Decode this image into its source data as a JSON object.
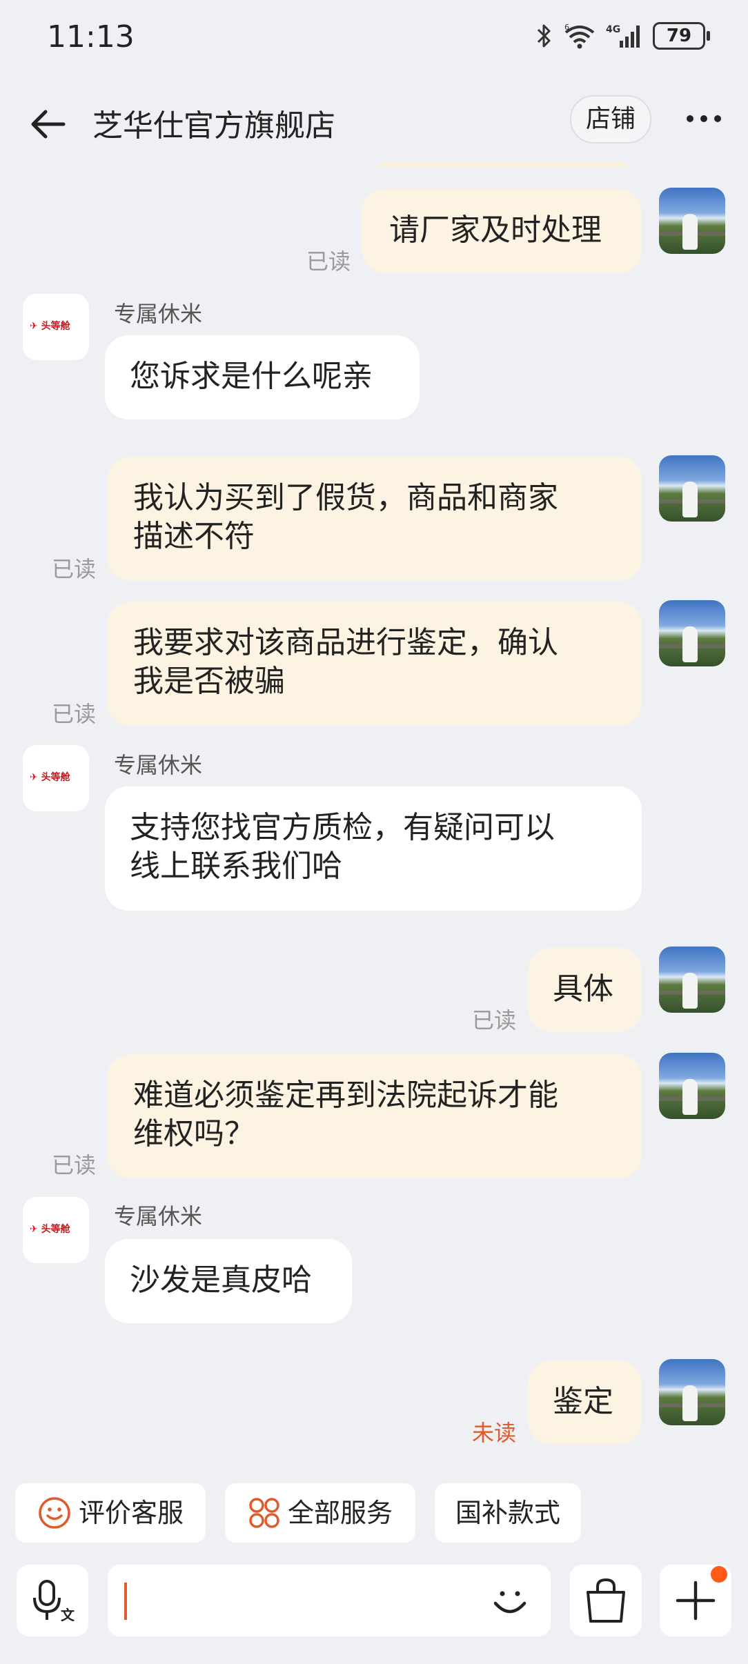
{
  "status_bar": {
    "time": "11:13",
    "battery": "79",
    "network": "4G"
  },
  "header": {
    "title": "芝华仕官方旗舰店",
    "store_label": "店铺"
  },
  "messages": [
    {
      "from": "me",
      "text": "请厂家及时处理",
      "status": "已读"
    },
    {
      "from": "other",
      "sender": "专属休米",
      "text": "您诉求是什么呢亲"
    },
    {
      "from": "me",
      "lines": [
        "我认为买到了假货，商品和商家",
        "描述不符"
      ],
      "status": "已读"
    },
    {
      "from": "me",
      "lines": [
        "我要求对该商品进行鉴定，确认",
        "我是否被骗"
      ],
      "status": "已读"
    },
    {
      "from": "other",
      "sender": "专属休米",
      "lines": [
        "支持您找官方质检，有疑问可以",
        "线上联系我们哈"
      ]
    },
    {
      "from": "me",
      "text": "具体",
      "status": "已读"
    },
    {
      "from": "me",
      "lines": [
        "难道必须鉴定再到法院起诉才能",
        "维权吗？"
      ],
      "status": "已读"
    },
    {
      "from": "other",
      "sender": "专属休米",
      "text": "沙发是真皮哈"
    },
    {
      "from": "me",
      "text": "鉴定",
      "status": "未读"
    }
  ],
  "shop_avatar_text": "头等舱",
  "quick_actions": [
    {
      "label": "评价客服",
      "icon": "smile-icon"
    },
    {
      "label": "全部服务",
      "icon": "grid-icon"
    },
    {
      "label": "国补款式"
    }
  ],
  "input": {
    "voice_sub": "文"
  },
  "colors": {
    "accent": "#e05a2b",
    "my_bubble": "#fdf3e2",
    "other_bubble": "#ffffff",
    "background": "#eef0f3",
    "badge": "#ff5a16"
  }
}
